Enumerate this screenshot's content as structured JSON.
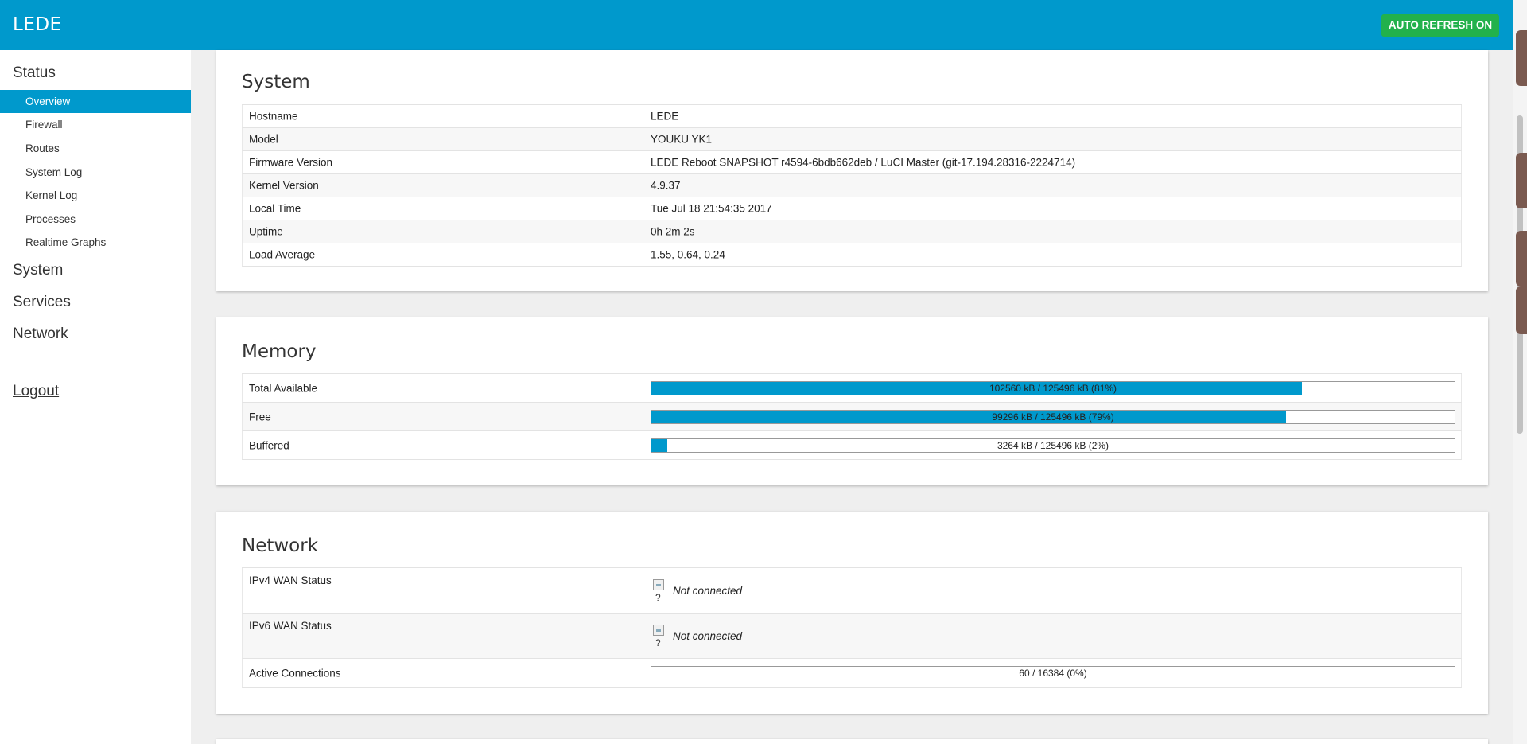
{
  "header": {
    "brand": "LEDE",
    "auto_refresh": "AUTO REFRESH ON",
    "brand_color": "#0099cc",
    "refresh_color": "#22b14c"
  },
  "sidebar": {
    "sections": [
      {
        "label": "Status"
      },
      {
        "label": "System"
      },
      {
        "label": "Services"
      },
      {
        "label": "Network"
      }
    ],
    "status_items": [
      {
        "label": "Overview",
        "active": true
      },
      {
        "label": "Firewall"
      },
      {
        "label": "Routes"
      },
      {
        "label": "System Log"
      },
      {
        "label": "Kernel Log"
      },
      {
        "label": "Processes"
      },
      {
        "label": "Realtime Graphs"
      }
    ],
    "logout": "Logout"
  },
  "system": {
    "title": "System",
    "rows": [
      {
        "key": "Hostname",
        "value": "LEDE"
      },
      {
        "key": "Model",
        "value": "YOUKU YK1"
      },
      {
        "key": "Firmware Version",
        "value": "LEDE Reboot SNAPSHOT r4594-6bdb662deb / LuCI Master (git-17.194.28316-2224714)"
      },
      {
        "key": "Kernel Version",
        "value": "4.9.37"
      },
      {
        "key": "Local Time",
        "value": "Tue Jul 18 21:54:35 2017"
      },
      {
        "key": "Uptime",
        "value": "0h 2m 2s"
      },
      {
        "key": "Load Average",
        "value": "1.55, 0.64, 0.24"
      }
    ]
  },
  "memory": {
    "title": "Memory",
    "rows": [
      {
        "key": "Total Available",
        "text": "102560 kB / 125496 kB (81%)",
        "fraction": 0.81
      },
      {
        "key": "Free",
        "text": "99296 kB / 125496 kB (79%)",
        "fraction": 0.79
      },
      {
        "key": "Buffered",
        "text": "3264 kB / 125496 kB (2%)",
        "fraction": 0.02
      }
    ]
  },
  "network": {
    "title": "Network",
    "ipv4": {
      "key": "IPv4 WAN Status",
      "icon_glyph": "?",
      "status": "Not connected"
    },
    "ipv6": {
      "key": "IPv6 WAN Status",
      "icon_glyph": "?",
      "status": "Not connected"
    },
    "connections": {
      "key": "Active Connections",
      "text": "60 / 16384 (0%)",
      "fraction": 0.0
    }
  }
}
